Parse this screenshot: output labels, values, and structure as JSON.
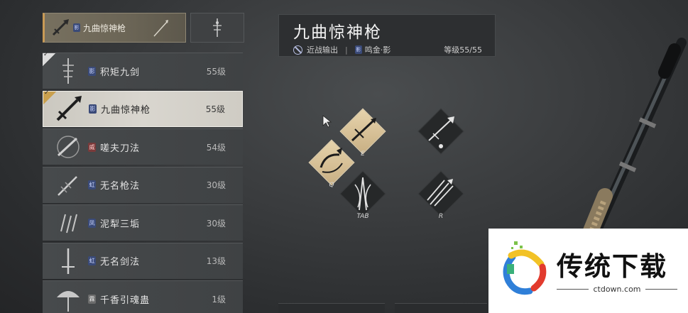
{
  "equipped": {
    "main_label": "九曲惊神枪"
  },
  "weapons": [
    {
      "name": "积矩九剑",
      "level": "55级",
      "badge": "影",
      "badge_color": "blue"
    },
    {
      "name": "九曲惊神枪",
      "level": "55级",
      "badge": "影",
      "badge_color": "blue"
    },
    {
      "name": "嗟夫刀法",
      "level": "54级",
      "badge": "威",
      "badge_color": "red"
    },
    {
      "name": "无名枪法",
      "level": "30级",
      "badge": "虹",
      "badge_color": "blue"
    },
    {
      "name": "泥犁三垢",
      "level": "30级",
      "badge": "凤",
      "badge_color": "blue"
    },
    {
      "name": "无名剑法",
      "level": "13级",
      "badge": "虹",
      "badge_color": "blue"
    },
    {
      "name": "千香引魂蛊",
      "level": "1级",
      "badge": "霖",
      "badge_color": "pale"
    }
  ],
  "header": {
    "title": "九曲惊神枪",
    "role": "近战输出",
    "separator": "|",
    "school": "鸣金·影",
    "grade": "等级55/55"
  },
  "skills": {
    "q_key": "Q",
    "e_key": "E",
    "tab_key": "TAB",
    "r_key": "R"
  },
  "watermark": {
    "title": "传统下载",
    "url": "ctdown.com"
  },
  "colors": {
    "selected_row": "#d9d6cf",
    "gold_accent": "#c89a55",
    "skill_gold": "#e6d3ac",
    "badge_blue": "#3a4a78"
  }
}
